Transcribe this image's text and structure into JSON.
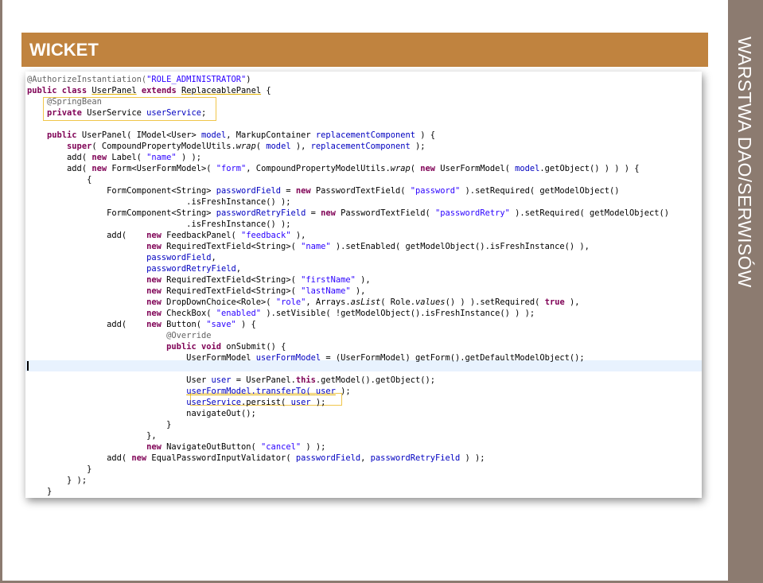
{
  "slide": {
    "title": "WICKET",
    "sidebar_title": "WARSTWA DAO/SERWISÓW"
  },
  "code": {
    "l1": {
      "a": "@AuthorizeInstantiation(",
      "b": "\"ROLE_ADMINISTRATOR\"",
      "c": ")"
    },
    "l2": {
      "a": "public class",
      "b": " ",
      "c": "UserPanel",
      "d": " ",
      "e": "extends",
      "f": " ",
      "g": "ReplaceablePanel",
      "h": " {"
    },
    "l3": {
      "a": "    @SpringBean"
    },
    "l4": {
      "a": "    ",
      "b": "private",
      "c": " UserService ",
      "d": "userService",
      "e": ";"
    },
    "l5": {
      "a": ""
    },
    "l6": {
      "a": "    ",
      "b": "public",
      "c": " UserPanel( IModel<User> ",
      "d": "model",
      "e": ", MarkupContainer ",
      "f": "replacementComponent",
      "g": " ) {"
    },
    "l7": {
      "a": "        ",
      "b": "super",
      "c": "( CompoundPropertyModelUtils.",
      "d": "wrap",
      "e": "( ",
      "f": "model",
      "g": " ), ",
      "h": "replacementComponent",
      "i": " );"
    },
    "l8": {
      "a": "        add( ",
      "b": "new",
      "c": " Label( ",
      "d": "\"name\"",
      "e": " ) );"
    },
    "l9": {
      "a": "        add( ",
      "b": "new",
      "c": " Form<UserFormModel>( ",
      "d": "\"form\"",
      "e": ", CompoundPropertyModelUtils.",
      "f": "wrap",
      "g": "( ",
      "h": "new",
      "i": " UserFormModel( ",
      "j": "model",
      "k": ".getObject() ) ) ) {"
    },
    "l10": {
      "a": "            {"
    },
    "l11": {
      "a": "                FormComponent<String> ",
      "b": "passwordField",
      "c": " = ",
      "d": "new",
      "e": " PasswordTextField( ",
      "f": "\"password\"",
      "g": " ).setRequired( getModelObject()"
    },
    "l12": {
      "a": "                                .isFreshInstance() );"
    },
    "l13": {
      "a": "                FormComponent<String> ",
      "b": "passwordRetryField",
      "c": " = ",
      "d": "new",
      "e": " PasswordTextField( ",
      "f": "\"passwordRetry\"",
      "g": " ).setRequired( getModelObject()"
    },
    "l14": {
      "a": "                                .isFreshInstance() );"
    },
    "l15": {
      "a": "                add(    ",
      "b": "new",
      "c": " FeedbackPanel( ",
      "d": "\"feedback\"",
      "e": " ),"
    },
    "l16": {
      "a": "                        ",
      "b": "new",
      "c": " RequiredTextField<String>( ",
      "d": "\"name\"",
      "e": " ).setEnabled( getModelObject().isFreshInstance() ),"
    },
    "l17": {
      "a": "                        ",
      "b": "passwordField",
      "c": ","
    },
    "l18": {
      "a": "                        ",
      "b": "passwordRetryField",
      "c": ","
    },
    "l19": {
      "a": "                        ",
      "b": "new",
      "c": " RequiredTextField<String>( ",
      "d": "\"firstName\"",
      "e": " ),"
    },
    "l20": {
      "a": "                        ",
      "b": "new",
      "c": " RequiredTextField<String>( ",
      "d": "\"lastName\"",
      "e": " ),"
    },
    "l21": {
      "a": "                        ",
      "b": "new",
      "c": " DropDownChoice<Role>( ",
      "d": "\"role\"",
      "e": ", Arrays.",
      "f": "asList",
      "g": "( Role.",
      "h": "values",
      "i": "() ) ).setRequired( ",
      "j": "true",
      "k": " ),"
    },
    "l22": {
      "a": "                        ",
      "b": "new",
      "c": " CheckBox( ",
      "d": "\"enabled\"",
      "e": " ).setVisible( !getModelObject().isFreshInstance() ) );"
    },
    "l23": {
      "a": "                add(    ",
      "b": "new",
      "c": " Button( ",
      "d": "\"save\"",
      "e": " ) {"
    },
    "l24": {
      "a": "                            @Override"
    },
    "l25": {
      "a": "                            ",
      "b": "public",
      "c": " ",
      "d": "void",
      "e": " onSubmit() {"
    },
    "l26": {
      "a": "                                UserFormModel ",
      "b": "userFormModel",
      "c": " = (UserFormModel) getForm().getDefaultModelObject();"
    },
    "l27": {
      "a": ""
    },
    "l28": {
      "a": "                                User ",
      "b": "user",
      "c": " = UserPanel.",
      "d": "this",
      "e": ".getModel().getObject();"
    },
    "l29": {
      "a": "                                ",
      "b": "userFormModel.transferTo( ",
      "c": "user",
      "d": " );"
    },
    "l30": {
      "a": "                                ",
      "b": "userService",
      "c": ".persist( ",
      "d": "user",
      "e": " );"
    },
    "l31": {
      "a": "                                navigateOut();"
    },
    "l32": {
      "a": "                            }"
    },
    "l33": {
      "a": "                        },"
    },
    "l34": {
      "a": "                        ",
      "b": "new",
      "c": " NavigateOutButton( ",
      "d": "\"cancel\"",
      "e": " ) );"
    },
    "l35": {
      "a": "                add( ",
      "b": "new",
      "c": " EqualPasswordInputValidator( ",
      "d": "passwordField",
      "e": ", ",
      "f": "passwordRetryField",
      "g": " ) );"
    },
    "l36": {
      "a": "            }"
    },
    "l37": {
      "a": "        } );"
    },
    "l38": {
      "a": "    }"
    }
  }
}
